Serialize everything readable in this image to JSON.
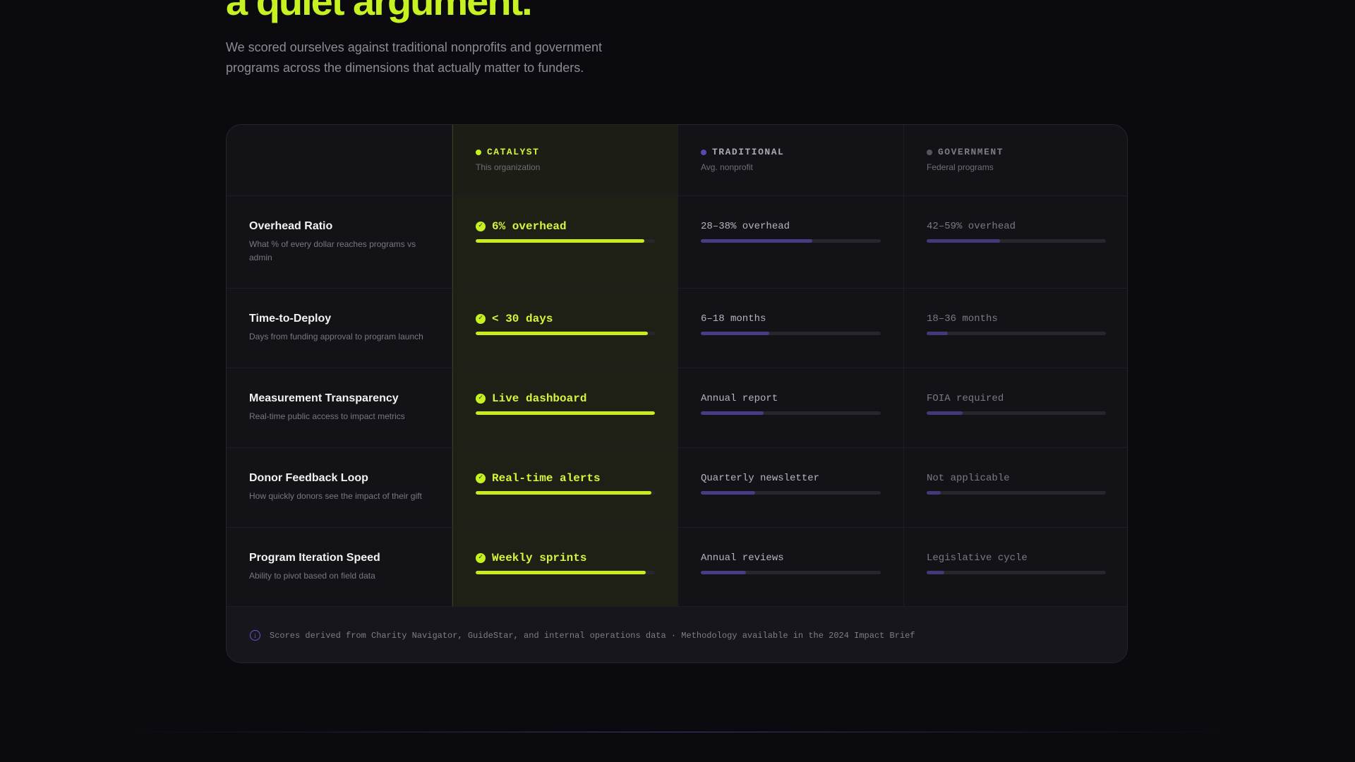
{
  "hero": {
    "title": "a quiet argument.",
    "subtitle": "We scored ourselves against traditional nonprofits and government programs across the dimensions that actually matter to funders."
  },
  "columns": [
    {
      "label": "CATALYST",
      "sub": "This organization",
      "color": "#c6f221"
    },
    {
      "label": "TRADITIONAL",
      "sub": "Avg. nonprofit",
      "color": "#5b46b0"
    },
    {
      "label": "GOVERNMENT",
      "sub": "Federal programs",
      "color": "#55555e"
    }
  ],
  "rows": [
    {
      "title": "Overhead Ratio",
      "desc": "What % of every dollar reaches programs vs admin",
      "catalyst": {
        "text": "6% overhead",
        "score": 94
      },
      "traditional": {
        "text": "28–38% overhead",
        "score": 62
      },
      "government": {
        "text": "42–59% overhead",
        "score": 41
      }
    },
    {
      "title": "Time-to-Deploy",
      "desc": "Days from funding approval to program launch",
      "catalyst": {
        "text": "< 30 days",
        "score": 96
      },
      "traditional": {
        "text": "6–18 months",
        "score": 38
      },
      "government": {
        "text": "18–36 months",
        "score": 12
      }
    },
    {
      "title": "Measurement Transparency",
      "desc": "Real-time public access to impact metrics",
      "catalyst": {
        "text": "Live dashboard",
        "score": 100
      },
      "traditional": {
        "text": "Annual report",
        "score": 35
      },
      "government": {
        "text": "FOIA required",
        "score": 20
      }
    },
    {
      "title": "Donor Feedback Loop",
      "desc": "How quickly donors see the impact of their gift",
      "catalyst": {
        "text": "Real-time alerts",
        "score": 98
      },
      "traditional": {
        "text": "Quarterly newsletter",
        "score": 30
      },
      "government": {
        "text": "Not applicable",
        "score": 8
      }
    },
    {
      "title": "Program Iteration Speed",
      "desc": "Ability to pivot based on field data",
      "catalyst": {
        "text": "Weekly sprints",
        "score": 95
      },
      "traditional": {
        "text": "Annual reviews",
        "score": 25
      },
      "government": {
        "text": "Legislative cycle",
        "score": 10
      }
    }
  ],
  "footer": {
    "icon": "info-icon",
    "note": "Scores derived from Charity Navigator, GuideStar, and internal operations data · Methodology available in the 2024 Impact Brief"
  }
}
